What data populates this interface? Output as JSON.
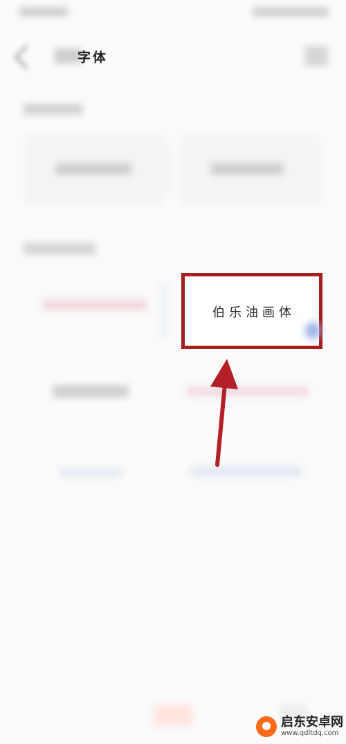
{
  "header": {
    "title": "字体"
  },
  "highlight": {
    "font_name": "伯乐油画体"
  },
  "watermark": {
    "brand": "启东安卓网",
    "url": "www.qdltdq.com"
  },
  "colors": {
    "highlight_border": "#a81d1d",
    "arrow": "#b21f24",
    "watermark_orange": "#ff6a1a"
  }
}
